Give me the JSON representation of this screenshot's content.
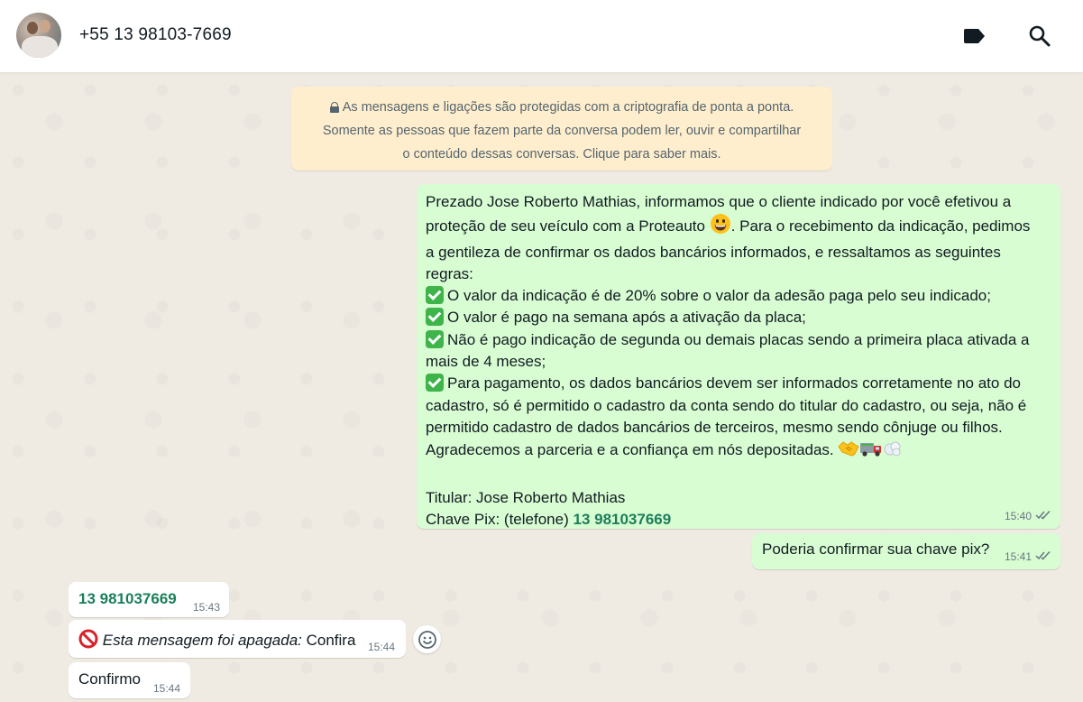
{
  "header": {
    "contact_name": "+55 13 98103-7669",
    "icons": [
      "label-icon",
      "search-icon"
    ]
  },
  "encryption_notice": {
    "lines": [
      "As mensagens e ligações são protegidas com a criptografia de ponta a ponta.",
      "Somente as pessoas que fazem parte da conversa podem ler, ouvir e compartilhar",
      "o conteúdo dessas conversas. Clique para saber mais."
    ]
  },
  "messages": [
    {
      "direction": "outgoing",
      "lines": [
        "Prezado Jose Roberto Mathias, informamos que o cliente indicado por você efetivou a",
        "proteção de seu veículo com a Proteauto",
        ". Para o recebimento da indicação, pedimos",
        "a gentileza de confirmar os dados bancários informados, e  ressaltamos as seguintes",
        "regras:",
        "O valor da indicação é de 20% sobre o valor da adesão paga pelo seu indicado;",
        "O valor é pago na semana após a ativação da placa;",
        "Não é pago indicação de segunda ou demais placas sendo a primeira placa ativada a",
        "mais de 4 meses;",
        "Para pagamento, os dados bancários devem ser informados corretamente no ato do",
        "cadastro, só é permitido o cadastro da conta sendo do titular do cadastro, ou seja, não é",
        "permitido cadastro de dados bancários de terceiros, mesmo sendo cônjuge ou filhos.",
        "Agradecemos a parceria e a confiança em nós depositadas.",
        "Titular: Jose Roberto Mathias",
        "Chave Pix: (telefone)",
        "13 981037669"
      ],
      "time": "15:40",
      "status": "read"
    },
    {
      "direction": "outgoing",
      "text": "Poderia confirmar sua chave pix?",
      "time": "15:41",
      "status": "read"
    },
    {
      "direction": "incoming",
      "text": "13 981037669",
      "time": "15:43"
    },
    {
      "direction": "incoming",
      "deleted_label": "Esta mensagem foi apagada:",
      "text": "Confira",
      "time": "15:44"
    },
    {
      "direction": "incoming",
      "text": "Confirmo",
      "time": "15:44"
    }
  ],
  "colors": {
    "outgoing_bubble": "#d9fdd3",
    "incoming_bubble": "#ffffff",
    "chat_background": "#efeae2",
    "link": "#1b7e5a",
    "read_ticks": "#667781"
  }
}
